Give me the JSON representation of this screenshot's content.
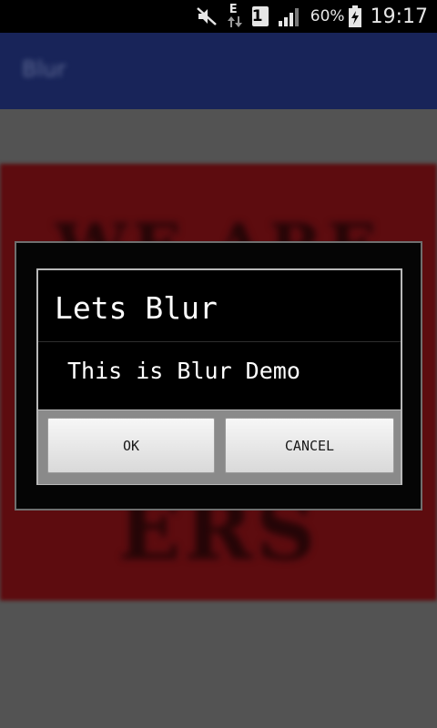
{
  "status_bar": {
    "data_letter": "E",
    "sim_slot": "1",
    "battery_percent": "60%",
    "time": "19:17",
    "icons": [
      "mute-icon",
      "data-arrows-icon",
      "sim-icon",
      "signal-icon",
      "battery-charging-icon"
    ]
  },
  "app": {
    "title": "Blur",
    "background_text_top": "WE ARE",
    "background_text_bottom": "ERS"
  },
  "dialog": {
    "title": "Lets Blur",
    "message": "This is Blur Demo",
    "ok_label": "OK",
    "cancel_label": "CANCEL"
  },
  "colors": {
    "app_bar": "#1c2a66",
    "red_band": "#6a0e12",
    "gray_background": "#5f5f5f",
    "dialog_background": "#000000"
  }
}
